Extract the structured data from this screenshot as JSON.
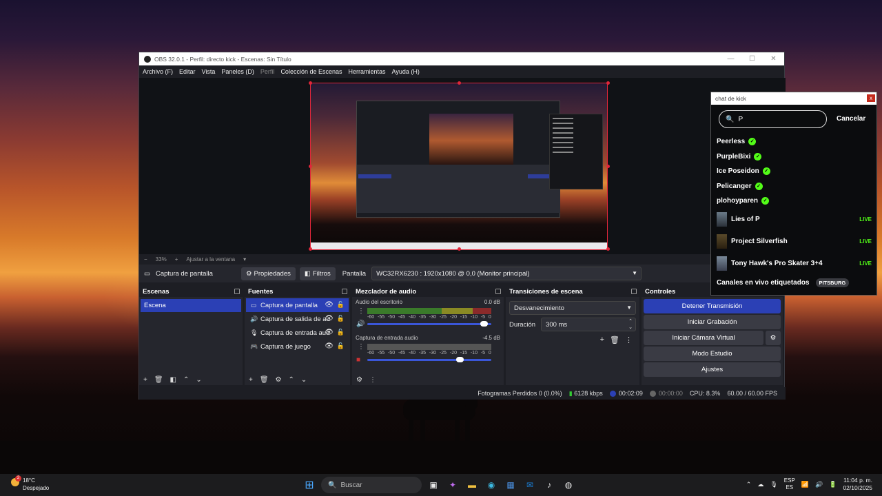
{
  "window": {
    "title": "OBS 32.0.1 - Perfil: directo kick - Escenas: Sin Título",
    "controls": [
      "—",
      "☐",
      "✕"
    ]
  },
  "menu": {
    "items": [
      "Archivo (F)",
      "Editar",
      "Vista",
      "Paneles (D)",
      "Perfil",
      "Colección de Escenas",
      "Herramientas",
      "Ayuda (H)"
    ]
  },
  "zoombar": {
    "minus": "−",
    "zoom": "33%",
    "plus": "+",
    "fit": "Ajustar a la ventana",
    "caret": "▾"
  },
  "sourcebar": {
    "source": "Captura de pantalla",
    "properties": "Propiedades",
    "filters": "Filtros",
    "display_label": "Pantalla",
    "display_value": "WC32RX6230   : 1920x1080 @ 0,0 (Monitor principal)"
  },
  "scenes": {
    "title": "Escenas",
    "items": [
      "Escena"
    ]
  },
  "sources": {
    "title": "Fuentes",
    "items": [
      {
        "label": "Captura de pantalla",
        "icon": "monitor-icon"
      },
      {
        "label": "Captura de salida de au",
        "icon": "speaker-icon"
      },
      {
        "label": "Captura de entrada aud",
        "icon": "microphone-icon"
      },
      {
        "label": "Captura de juego",
        "icon": "gamepad-icon"
      }
    ]
  },
  "mixer": {
    "title": "Mezclador de audio",
    "channels": [
      {
        "name": "Audio del escritorio",
        "db": "0.0 dB",
        "volume": 0.97
      },
      {
        "name": "Captura de entrada audio",
        "db": "-4.5 dB",
        "volume": 0.78
      }
    ],
    "ticks": [
      "-60",
      "-55",
      "-50",
      "-45",
      "-40",
      "-35",
      "-30",
      "-25",
      "-20",
      "-15",
      "-10",
      "-5",
      "0"
    ]
  },
  "transitions": {
    "title": "Transiciones de escena",
    "type": "Desvanecimiento",
    "duration_label": "Duración",
    "duration": "300 ms"
  },
  "controls": {
    "title": "Controles",
    "stop_stream": "Detener Transmisión",
    "start_record": "Iniciar Grabación",
    "virtual_cam": "Iniciar Cámara Virtual",
    "studio": "Modo Estudio",
    "settings": "Ajustes"
  },
  "status": {
    "dropped": "Fotogramas Perdidos 0 (0.0%)",
    "bitrate": "6128 kbps",
    "stream_time": "00:02:09",
    "rec_time": "00:00:00",
    "cpu": "CPU: 8.3%",
    "fps": "60.00 / 60.00 FPS"
  },
  "chat": {
    "title": "chat de kick",
    "query": "P",
    "cancel": "Cancelar",
    "users": [
      "Peerless",
      "PurpleBixi",
      "Ice Poseidon",
      "Pelicanger",
      "plohoyparen"
    ],
    "categories": [
      {
        "name": "Lies of P",
        "live": "LIVE"
      },
      {
        "name": "Project Silverfish",
        "live": "LIVE"
      },
      {
        "name": "Tony Hawk's Pro Skater 3+4",
        "live": "LIVE"
      }
    ],
    "tagged_label": "Canales en vivo etiquetados",
    "tag": "PITSBURG"
  },
  "taskbar": {
    "temp": "18°C",
    "weather": "Despejado",
    "weather_badge": "2",
    "search": "Buscar",
    "lang_top": "ESP",
    "lang_bottom": "ES",
    "time": "11:04 p. m.",
    "date": "02/10/2025"
  }
}
